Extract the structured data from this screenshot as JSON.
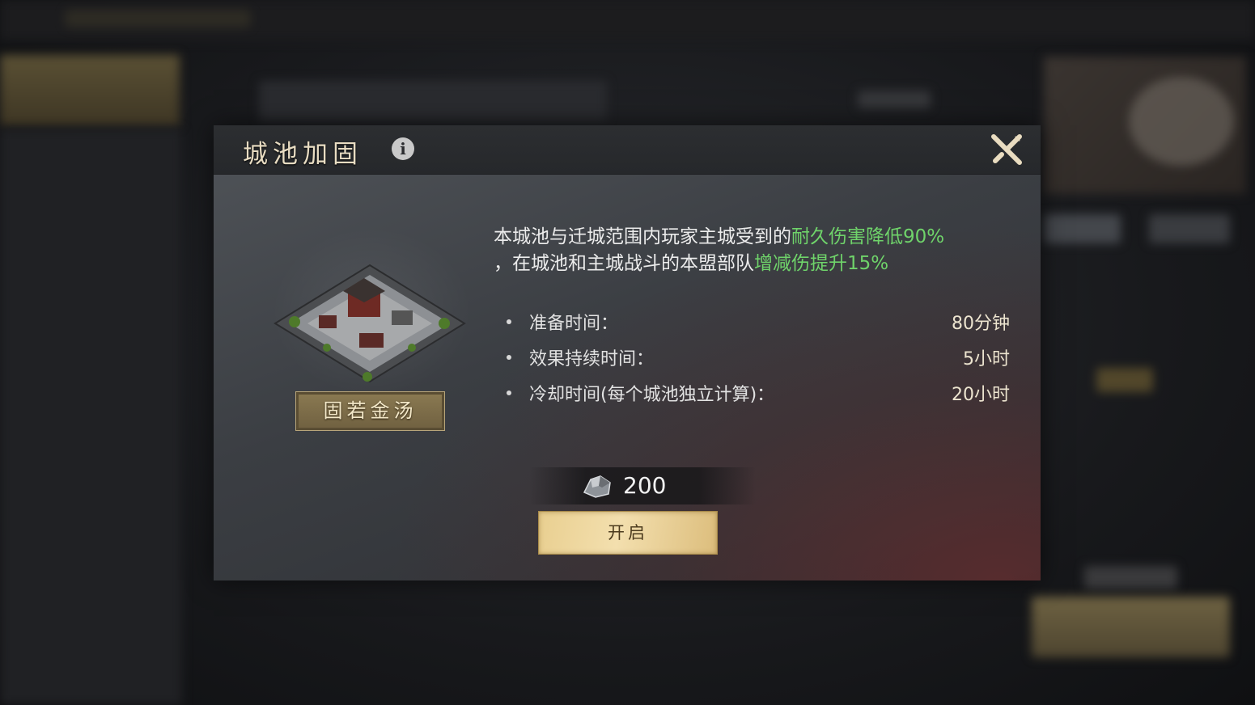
{
  "dialog": {
    "title": "城池加固",
    "skill_name": "固若金汤",
    "description": {
      "part1": "本城池与迁城范围内玩家主城受到的",
      "highlight1": "耐久伤害降低90%",
      "part2": "，在城池和主城战斗的本盟部队",
      "highlight2": "增减伤提升15%"
    },
    "stats": [
      {
        "label": "准备时间：",
        "value": "80分钟"
      },
      {
        "label": "效果持续时间：",
        "value": "5小时"
      },
      {
        "label": "冷却时间(每个城池独立计算)：",
        "value": "20小时"
      }
    ],
    "cost": {
      "icon": "ore-resource-icon",
      "value": "200"
    },
    "open_button": "开启"
  },
  "colors": {
    "highlight": "#6fd36a",
    "button_gold": "#f3dfae",
    "title_text": "#e8dcc2"
  }
}
